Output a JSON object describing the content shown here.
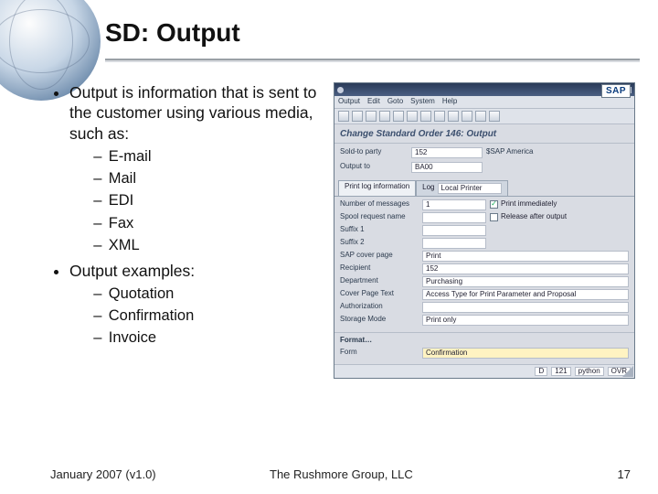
{
  "title": "SD: Output",
  "bullets": {
    "main1": "Output is information that is sent  to the customer using various media, such as:",
    "media": [
      "E-mail",
      "Mail",
      "EDI",
      "Fax",
      "XML"
    ],
    "main2": "Output examples:",
    "examples": [
      "Quotation",
      "Confirmation",
      "Invoice"
    ]
  },
  "footer": {
    "date": "January 2007 (v1.0)",
    "org": "The Rushmore Group, LLC",
    "page": "17"
  },
  "sap": {
    "logo": "SAP",
    "menu": [
      "Output",
      "Edit",
      "Goto",
      "System",
      "Help"
    ],
    "subtitle": "Change Standard Order 146: Output",
    "header": {
      "soldto_label": "Sold-to party",
      "soldto_value": "152",
      "soldto_text": "$SAP America",
      "outputto_label": "Output to",
      "outputto_value": "BA00"
    },
    "tabs": {
      "tab1": "Print log information",
      "tab2": "Log"
    },
    "log_value": "Local Printer",
    "form": [
      {
        "label": "Number of messages",
        "value": "1",
        "check_label": "Print immediately",
        "checked": true
      },
      {
        "label": "Spool request name",
        "value": "",
        "check_label": "Release after output",
        "checked": false
      },
      {
        "label": "Suffix 1",
        "value": ""
      },
      {
        "label": "Suffix 2",
        "value": ""
      },
      {
        "label": "SAP cover page",
        "value_wide": "Print"
      },
      {
        "label": "Recipient",
        "value_wide": "152"
      },
      {
        "label": "Department",
        "value_wide": "Purchasing"
      },
      {
        "label": "Cover Page Text",
        "value_wide": "Access Type for Print Parameter and Proposal"
      },
      {
        "label": "Authorization",
        "value_wide": ""
      },
      {
        "label": "Storage Mode",
        "value_wide": "Print only"
      }
    ],
    "format": {
      "section": "Format…",
      "form_label": "Form",
      "form_value": "Confirmation"
    },
    "status": {
      "a": "D",
      "b": "121",
      "c": "python",
      "d": "OVR"
    }
  }
}
